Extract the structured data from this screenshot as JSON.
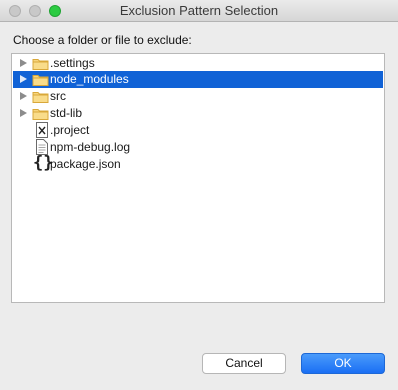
{
  "window": {
    "title": "Exclusion Pattern Selection"
  },
  "prompt": "Choose a folder or file to exclude:",
  "tree": {
    "items": [
      {
        "label": ".settings",
        "icon": "folder-icon",
        "expandable": true,
        "selected": false
      },
      {
        "label": "node_modules",
        "icon": "folder-icon",
        "expandable": true,
        "selected": true
      },
      {
        "label": "src",
        "icon": "folder-icon",
        "expandable": true,
        "selected": false
      },
      {
        "label": "std-lib",
        "icon": "folder-icon",
        "expandable": true,
        "selected": false
      },
      {
        "label": ".project",
        "icon": "xml-file-icon",
        "expandable": false,
        "selected": false
      },
      {
        "label": "npm-debug.log",
        "icon": "text-file-icon",
        "expandable": false,
        "selected": false
      },
      {
        "label": "package.json",
        "icon": "json-file-icon",
        "expandable": false,
        "selected": false
      }
    ]
  },
  "buttons": {
    "cancel": "Cancel",
    "ok": "OK"
  },
  "colors": {
    "selection": "#1062d6",
    "folder": "#f2c458",
    "ok_button": "#1a6ff4"
  }
}
